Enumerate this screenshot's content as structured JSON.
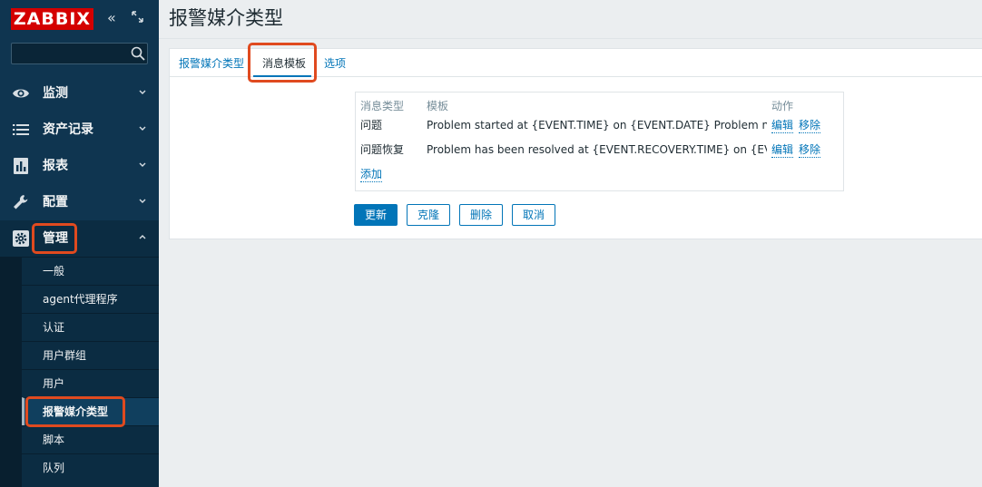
{
  "sidebar": {
    "logo": "ZABBIX",
    "collapse_glyph": "«",
    "search": {
      "value": "",
      "placeholder": ""
    },
    "menu": [
      {
        "label": "监测",
        "icon": "eye-icon"
      },
      {
        "label": "资产记录",
        "icon": "list-icon"
      },
      {
        "label": "报表",
        "icon": "bar-chart-icon"
      },
      {
        "label": "配置",
        "icon": "wrench-icon"
      },
      {
        "label": "管理",
        "icon": "gear-icon",
        "expanded": true
      }
    ],
    "submenu": [
      "一般",
      "agent代理程序",
      "认证",
      "用户群组",
      "用户",
      "报警媒介类型",
      "脚本",
      "队列"
    ],
    "active_submenu": "报警媒介类型"
  },
  "page": {
    "title": "报警媒介类型"
  },
  "tabs": [
    {
      "label": "报警媒介类型"
    },
    {
      "label": "消息模板",
      "active": true
    },
    {
      "label": "选项"
    }
  ],
  "templates_table": {
    "headers": {
      "type": "消息类型",
      "template": "模板",
      "action": "动作"
    },
    "rows": [
      {
        "type": "问题",
        "template": "Problem started at {EVENT.TIME} on {EVENT.DATE} Problem name...",
        "edit": "编辑",
        "remove": "移除"
      },
      {
        "type": "问题恢复",
        "template": "Problem has been resolved at {EVENT.RECOVERY.TIME} on {EVE...",
        "edit": "编辑",
        "remove": "移除"
      }
    ],
    "add": "添加"
  },
  "buttons": {
    "update": "更新",
    "clone": "克隆",
    "delete": "删除",
    "cancel": "取消"
  },
  "colors": {
    "sidebar_bg": "#0f3550",
    "logo_bg": "#d40000",
    "link": "#0275b8",
    "highlight": "#e04a1f"
  }
}
